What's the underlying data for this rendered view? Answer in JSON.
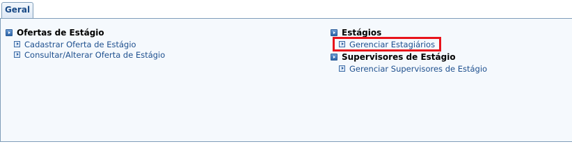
{
  "tabs": [
    {
      "label": "Geral"
    }
  ],
  "left": {
    "title": "Ofertas de Estágio",
    "items": [
      {
        "label": "Cadastrar Oferta de Estágio"
      },
      {
        "label": "Consultar/Alterar Oferta de Estágio"
      }
    ]
  },
  "right": {
    "sections": [
      {
        "title": "Estágios",
        "items": [
          {
            "label": "Gerenciar Estagiários"
          }
        ]
      },
      {
        "title": "Supervisores de Estágio",
        "items": [
          {
            "label": "Gerenciar Supervisores de Estágio"
          }
        ]
      }
    ]
  },
  "icons": {
    "section": "play-square-icon",
    "item": "play-outline-icon"
  },
  "colors": {
    "link": "#1d4f8e",
    "highlight": "#e8131b",
    "panel_bg": "#f5f9fd"
  }
}
